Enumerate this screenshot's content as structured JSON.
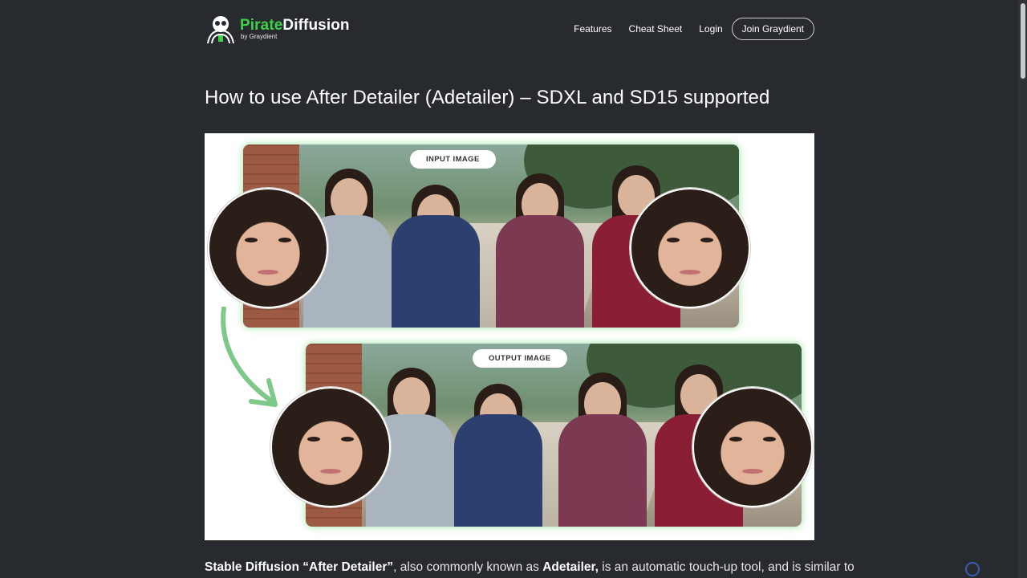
{
  "header": {
    "logo": {
      "brand_part1": "Pirate",
      "brand_part2": "Diffusion",
      "byline": "by Graydient"
    },
    "nav": [
      {
        "label": "Features"
      },
      {
        "label": "Cheat Sheet"
      },
      {
        "label": "Login"
      },
      {
        "label": "Join Graydient"
      }
    ]
  },
  "article": {
    "title": "How to use After Detailer (Adetailer) – SDXL and SD15 supported",
    "hero": {
      "input_label": "INPUT IMAGE",
      "output_label": "OUTPUT IMAGE"
    },
    "intro": {
      "bold1": "Stable Diffusion “After Detailer”",
      "text1": ", also commonly known as ",
      "bold2": "Adetailer,",
      "text2": " is an automatic touch-up tool, and is similar to"
    }
  },
  "colors": {
    "background": "#272a2e",
    "brand_green": "#3fd04a",
    "arrow_green": "#7ec88a"
  },
  "icons": {
    "logo": "skull-logo-icon",
    "arrow": "curved-arrow-icon",
    "badge": "recaptcha-icon"
  }
}
